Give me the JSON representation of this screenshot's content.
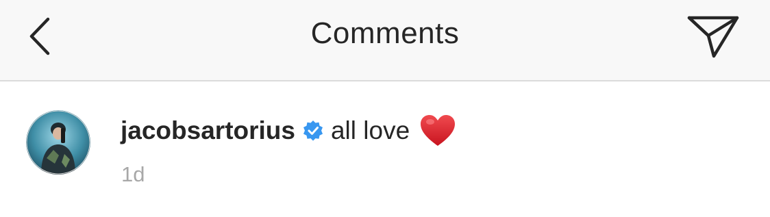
{
  "header": {
    "title": "Comments",
    "back_icon": "chevron-left-icon",
    "send_icon": "paper-plane-icon"
  },
  "comment": {
    "username": "jacobsartorius",
    "verified": true,
    "text": "all love",
    "emoji": "heart-icon",
    "timestamp": "1d"
  },
  "colors": {
    "header_bg": "#f8f8f8",
    "divider": "#dbdbdb",
    "text_primary": "#262626",
    "text_secondary": "#a8a8a8",
    "verified_blue": "#3897f0",
    "heart_red": "#e0212f"
  }
}
